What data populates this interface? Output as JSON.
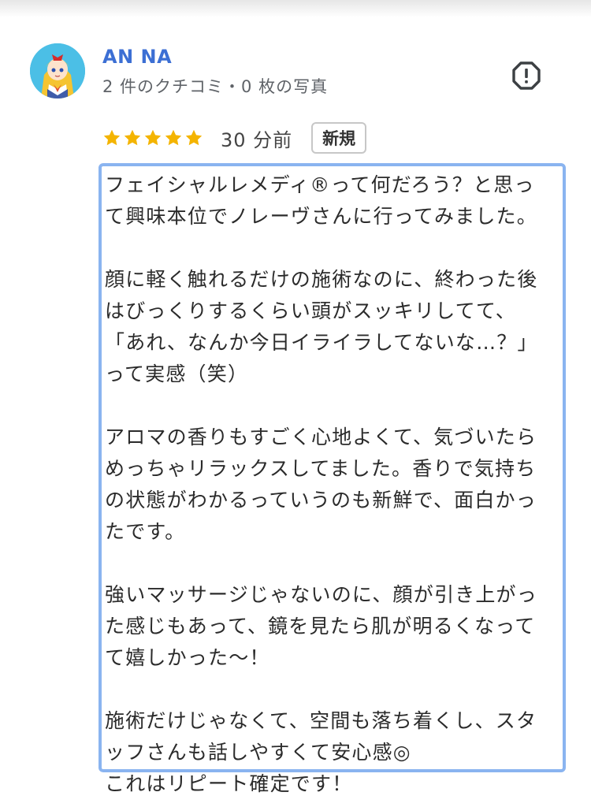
{
  "reviewer": {
    "name": "AN NA",
    "stats": "2 件のクチコミ・0 枚の写真",
    "avatar_icon": "anime-character-avatar"
  },
  "actions": {
    "report_icon": "report-flag-icon"
  },
  "rating": {
    "stars": 5,
    "max_stars": 5,
    "star_color": "#f4b400",
    "time": "30 分前",
    "badge": "新規"
  },
  "review": {
    "paragraphs": [
      [
        "フェイシャルレメディ®って何だろう？と思っ",
        "て興味本位でノレーヴさんに行ってみました。"
      ],
      [
        "顔に軽く触れるだけの施術なのに、終わった後",
        "はびっくりするくらい頭がスッキリしてて、",
        "「あれ、なんか今日イライラしてないな…？」",
        "って実感（笑）"
      ],
      [
        "アロマの香りもすごく心地よくて、気づいたら",
        "めっちゃリラックスしてました。香りで気持ち",
        "の状態がわかるっていうのも新鮮で、面白かっ",
        "たです。"
      ],
      [
        "強いマッサージじゃないのに、顔が引き上がっ",
        "た感じもあって、鏡を見たら肌が明るくなって",
        "て嬉しかった〜！"
      ],
      [
        "施術だけじゃなくて、空間も落ち着くし、スタ",
        "ッフさんも話しやすくて安心感◎",
        "これはリピート確定です！"
      ]
    ]
  },
  "colors": {
    "name": "#3c6fd4",
    "highlight_border": "#8ab4f0"
  }
}
